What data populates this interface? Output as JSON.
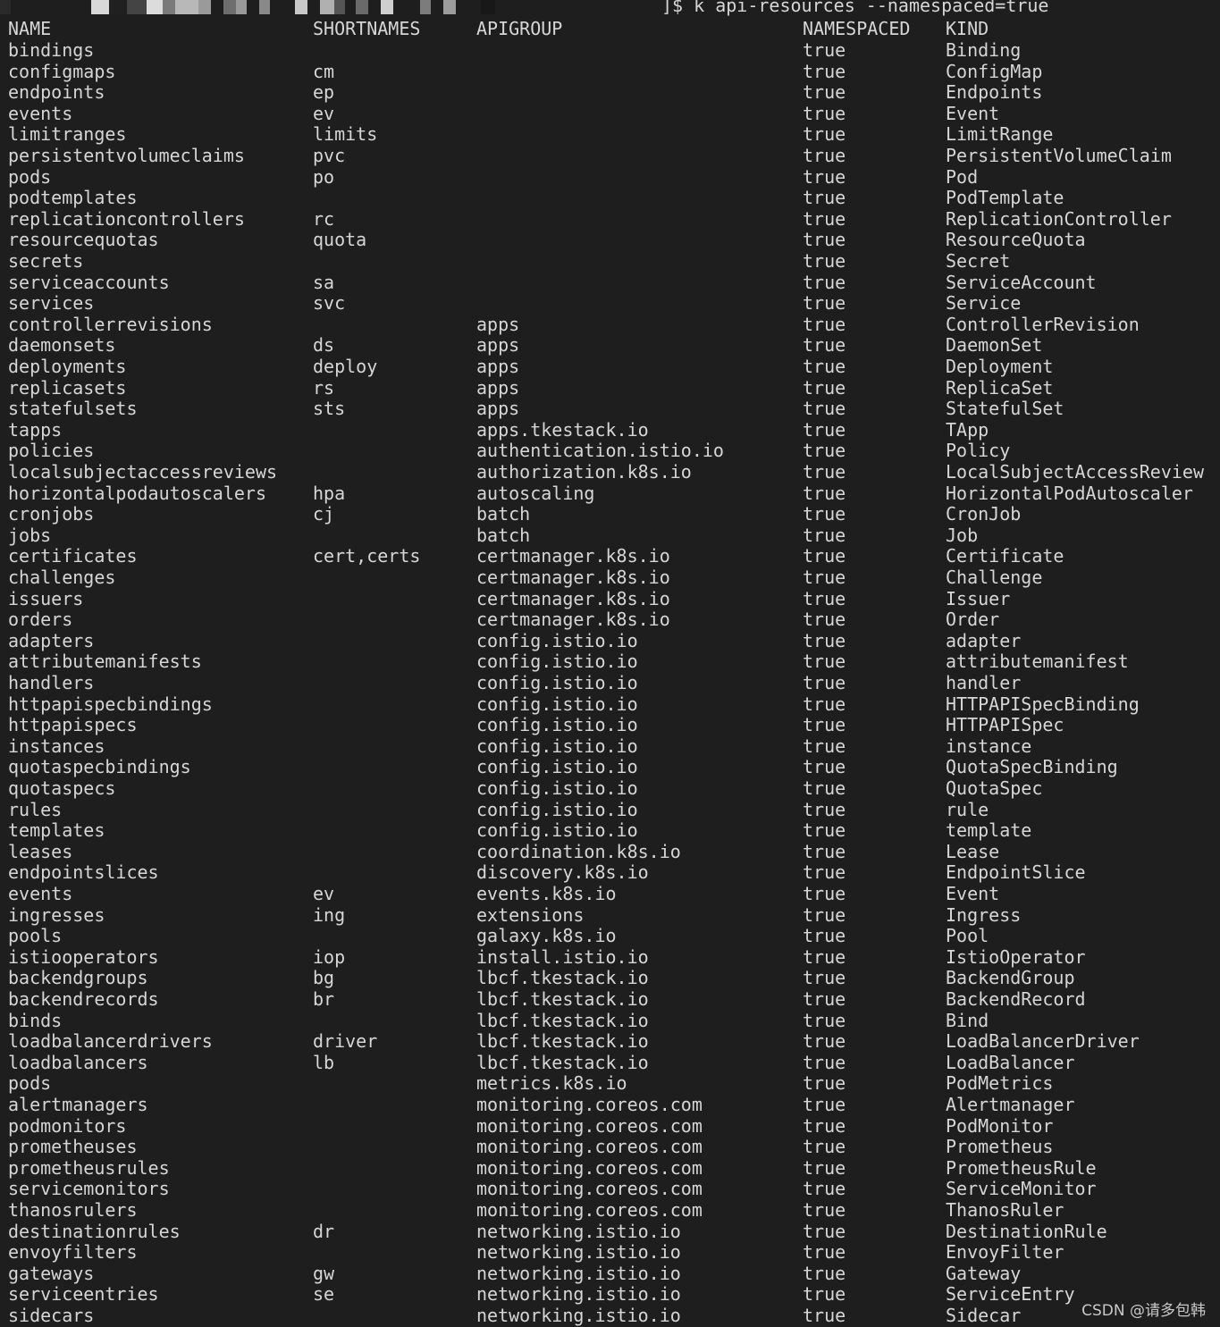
{
  "prompt": {
    "redacted": true,
    "command": "]$ k api-resources --namespaced=true"
  },
  "table": {
    "headers": [
      "NAME",
      "SHORTNAMES",
      "APIGROUP",
      "NAMESPACED",
      "KIND"
    ],
    "rows": [
      [
        "bindings",
        "",
        "",
        "true",
        "Binding"
      ],
      [
        "configmaps",
        "cm",
        "",
        "true",
        "ConfigMap"
      ],
      [
        "endpoints",
        "ep",
        "",
        "true",
        "Endpoints"
      ],
      [
        "events",
        "ev",
        "",
        "true",
        "Event"
      ],
      [
        "limitranges",
        "limits",
        "",
        "true",
        "LimitRange"
      ],
      [
        "persistentvolumeclaims",
        "pvc",
        "",
        "true",
        "PersistentVolumeClaim"
      ],
      [
        "pods",
        "po",
        "",
        "true",
        "Pod"
      ],
      [
        "podtemplates",
        "",
        "",
        "true",
        "PodTemplate"
      ],
      [
        "replicationcontrollers",
        "rc",
        "",
        "true",
        "ReplicationController"
      ],
      [
        "resourcequotas",
        "quota",
        "",
        "true",
        "ResourceQuota"
      ],
      [
        "secrets",
        "",
        "",
        "true",
        "Secret"
      ],
      [
        "serviceaccounts",
        "sa",
        "",
        "true",
        "ServiceAccount"
      ],
      [
        "services",
        "svc",
        "",
        "true",
        "Service"
      ],
      [
        "controllerrevisions",
        "",
        "apps",
        "true",
        "ControllerRevision"
      ],
      [
        "daemonsets",
        "ds",
        "apps",
        "true",
        "DaemonSet"
      ],
      [
        "deployments",
        "deploy",
        "apps",
        "true",
        "Deployment"
      ],
      [
        "replicasets",
        "rs",
        "apps",
        "true",
        "ReplicaSet"
      ],
      [
        "statefulsets",
        "sts",
        "apps",
        "true",
        "StatefulSet"
      ],
      [
        "tapps",
        "",
        "apps.tkestack.io",
        "true",
        "TApp"
      ],
      [
        "policies",
        "",
        "authentication.istio.io",
        "true",
        "Policy"
      ],
      [
        "localsubjectaccessreviews",
        "",
        "authorization.k8s.io",
        "true",
        "LocalSubjectAccessReview"
      ],
      [
        "horizontalpodautoscalers",
        "hpa",
        "autoscaling",
        "true",
        "HorizontalPodAutoscaler"
      ],
      [
        "cronjobs",
        "cj",
        "batch",
        "true",
        "CronJob"
      ],
      [
        "jobs",
        "",
        "batch",
        "true",
        "Job"
      ],
      [
        "certificates",
        "cert,certs",
        "certmanager.k8s.io",
        "true",
        "Certificate"
      ],
      [
        "challenges",
        "",
        "certmanager.k8s.io",
        "true",
        "Challenge"
      ],
      [
        "issuers",
        "",
        "certmanager.k8s.io",
        "true",
        "Issuer"
      ],
      [
        "orders",
        "",
        "certmanager.k8s.io",
        "true",
        "Order"
      ],
      [
        "adapters",
        "",
        "config.istio.io",
        "true",
        "adapter"
      ],
      [
        "attributemanifests",
        "",
        "config.istio.io",
        "true",
        "attributemanifest"
      ],
      [
        "handlers",
        "",
        "config.istio.io",
        "true",
        "handler"
      ],
      [
        "httpapispecbindings",
        "",
        "config.istio.io",
        "true",
        "HTTPAPISpecBinding"
      ],
      [
        "httpapispecs",
        "",
        "config.istio.io",
        "true",
        "HTTPAPISpec"
      ],
      [
        "instances",
        "",
        "config.istio.io",
        "true",
        "instance"
      ],
      [
        "quotaspecbindings",
        "",
        "config.istio.io",
        "true",
        "QuotaSpecBinding"
      ],
      [
        "quotaspecs",
        "",
        "config.istio.io",
        "true",
        "QuotaSpec"
      ],
      [
        "rules",
        "",
        "config.istio.io",
        "true",
        "rule"
      ],
      [
        "templates",
        "",
        "config.istio.io",
        "true",
        "template"
      ],
      [
        "leases",
        "",
        "coordination.k8s.io",
        "true",
        "Lease"
      ],
      [
        "endpointslices",
        "",
        "discovery.k8s.io",
        "true",
        "EndpointSlice"
      ],
      [
        "events",
        "ev",
        "events.k8s.io",
        "true",
        "Event"
      ],
      [
        "ingresses",
        "ing",
        "extensions",
        "true",
        "Ingress"
      ],
      [
        "pools",
        "",
        "galaxy.k8s.io",
        "true",
        "Pool"
      ],
      [
        "istiooperators",
        "iop",
        "install.istio.io",
        "true",
        "IstioOperator"
      ],
      [
        "backendgroups",
        "bg",
        "lbcf.tkestack.io",
        "true",
        "BackendGroup"
      ],
      [
        "backendrecords",
        "br",
        "lbcf.tkestack.io",
        "true",
        "BackendRecord"
      ],
      [
        "binds",
        "",
        "lbcf.tkestack.io",
        "true",
        "Bind"
      ],
      [
        "loadbalancerdrivers",
        "driver",
        "lbcf.tkestack.io",
        "true",
        "LoadBalancerDriver"
      ],
      [
        "loadbalancers",
        "lb",
        "lbcf.tkestack.io",
        "true",
        "LoadBalancer"
      ],
      [
        "pods",
        "",
        "metrics.k8s.io",
        "true",
        "PodMetrics"
      ],
      [
        "alertmanagers",
        "",
        "monitoring.coreos.com",
        "true",
        "Alertmanager"
      ],
      [
        "podmonitors",
        "",
        "monitoring.coreos.com",
        "true",
        "PodMonitor"
      ],
      [
        "prometheuses",
        "",
        "monitoring.coreos.com",
        "true",
        "Prometheus"
      ],
      [
        "prometheusrules",
        "",
        "monitoring.coreos.com",
        "true",
        "PrometheusRule"
      ],
      [
        "servicemonitors",
        "",
        "monitoring.coreos.com",
        "true",
        "ServiceMonitor"
      ],
      [
        "thanosrulers",
        "",
        "monitoring.coreos.com",
        "true",
        "ThanosRuler"
      ],
      [
        "destinationrules",
        "dr",
        "networking.istio.io",
        "true",
        "DestinationRule"
      ],
      [
        "envoyfilters",
        "",
        "networking.istio.io",
        "true",
        "EnvoyFilter"
      ],
      [
        "gateways",
        "gw",
        "networking.istio.io",
        "true",
        "Gateway"
      ],
      [
        "serviceentries",
        "se",
        "networking.istio.io",
        "true",
        "ServiceEntry"
      ],
      [
        "sidecars",
        "",
        "networking.istio.io",
        "true",
        "Sidecar"
      ]
    ]
  },
  "watermark": "CSDN @请多包韩"
}
